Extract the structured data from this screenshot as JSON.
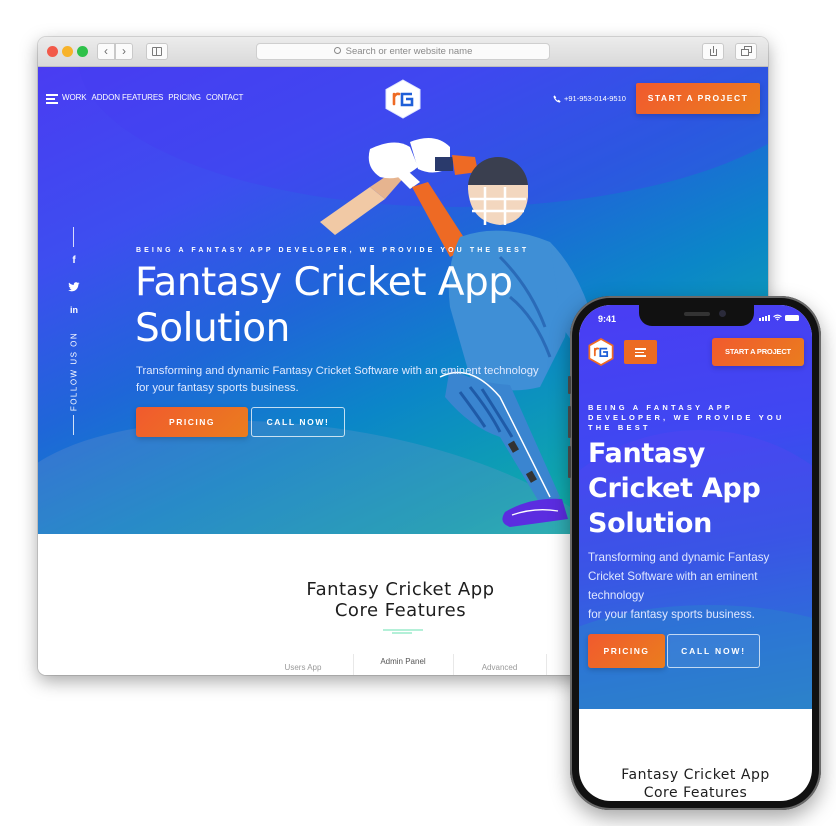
{
  "browser": {
    "address_placeholder": "Search or enter website name",
    "back_glyph": "‹",
    "forward_glyph": "›"
  },
  "desktop": {
    "nav": {
      "menu_icon": "hamburger-icon",
      "items": [
        "WORK",
        "ADDON FEATURES",
        "PRICING",
        "CONTACT"
      ]
    },
    "logo": "rG",
    "phone_number": "+91-953-014-9510",
    "start_project_label": "START A PROJECT",
    "social": {
      "facebook": "f",
      "twitter": "🐦",
      "linkedin": "in",
      "follow_label": "FOLLOW US ON"
    },
    "hero": {
      "eyebrow": "BEING A FANTASY APP DEVELOPER, WE PROVIDE YOU THE BEST",
      "headline_line1": "Fantasy Cricket App",
      "headline_line2": "Solution",
      "subtext_line1": "Transforming and dynamic Fantasy Cricket Software with an eminent technology",
      "subtext_line2": "for your fantasy sports business.",
      "pricing_label": "PRICING",
      "call_label": "CALL NOW!"
    },
    "features": {
      "title_line1": "Fantasy Cricket App",
      "title_line2": "Core Features",
      "tabs": [
        {
          "label": "Users App",
          "active": false
        },
        {
          "label": "Admin Panel",
          "active": true
        },
        {
          "label": "Advanced",
          "active": false
        }
      ]
    }
  },
  "mobile": {
    "status_time": "9:41",
    "logo": "rG",
    "start_project_label": "START A PROJECT",
    "hero": {
      "eyebrow": "BEING A FANTASY APP DEVELOPER, WE PROVIDE YOU THE BEST",
      "headline_line1": "Fantasy",
      "headline_line2": "Cricket App",
      "headline_line3": "Solution",
      "subtext_line1": "Transforming and dynamic Fantasy",
      "subtext_line2": "Cricket Software with an eminent",
      "subtext_line3": "technology",
      "subtext_line4": "for your fantasy sports business.",
      "pricing_label": "PRICING",
      "call_label": "CALL NOW!"
    },
    "features": {
      "title_line1": "Fantasy Cricket App",
      "title_line2": "Core Features"
    }
  },
  "colors": {
    "accent_orange": "#EE6A24",
    "hero_start": "#4A3CF2",
    "hero_end": "#1BD3A0",
    "feature_underline": "#B4F0D8"
  }
}
